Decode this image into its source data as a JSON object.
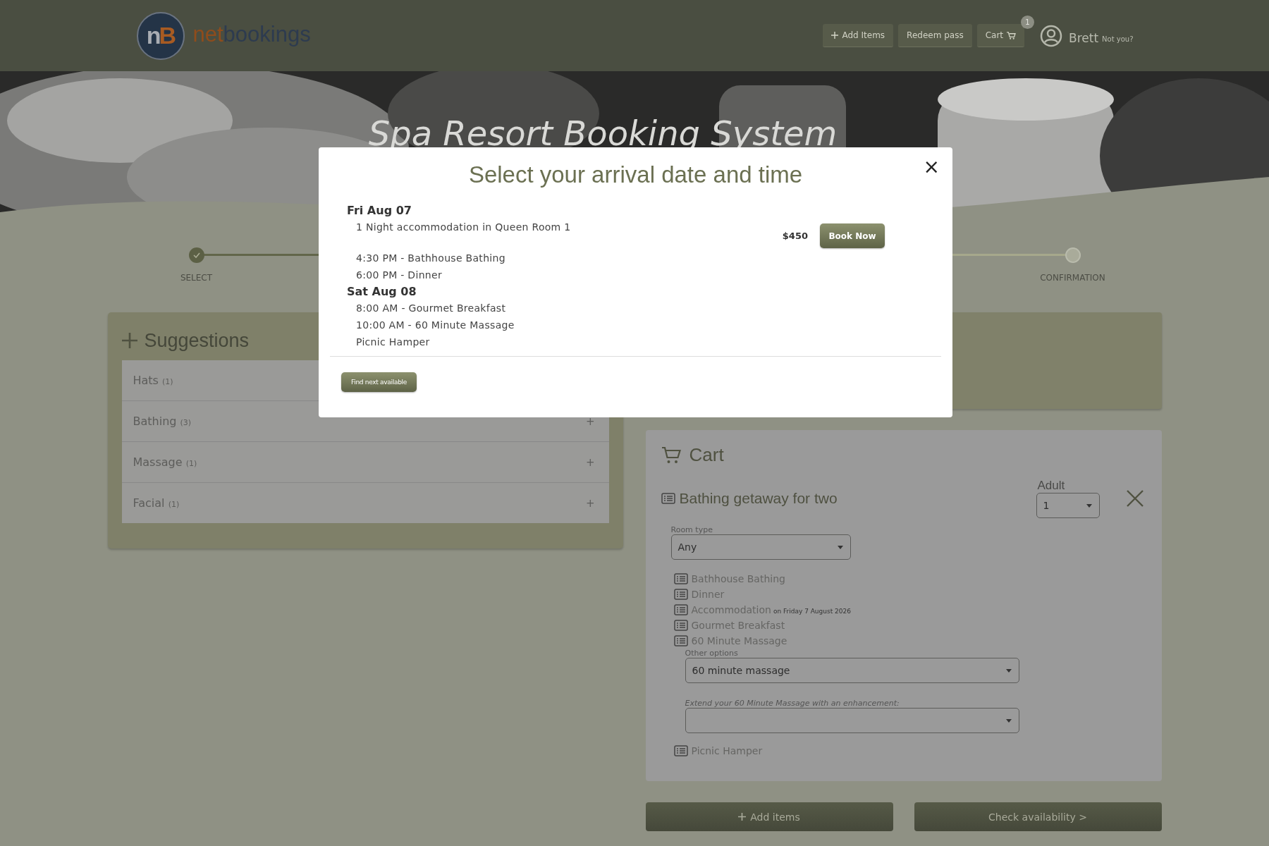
{
  "header": {
    "logo_mark": [
      "n",
      "B"
    ],
    "logo_text": [
      "net",
      "bookings"
    ],
    "buttons": [
      {
        "kind": "add",
        "label": "Add Items"
      },
      {
        "kind": "plain",
        "label": "Redeem pass"
      },
      {
        "kind": "cart",
        "label": "Cart",
        "badge": "1"
      }
    ],
    "user": {
      "name": "Brett",
      "link": "Not you?"
    }
  },
  "hero": {
    "title": "Spa Resort Booking System"
  },
  "steps": [
    {
      "label": "SELECT",
      "done": true
    },
    {
      "label": "CONFIRMATION",
      "done": false
    }
  ],
  "suggestions": {
    "title": "Suggestions",
    "items": [
      {
        "name": "Hats",
        "count": "(1)"
      },
      {
        "name": "Bathing",
        "count": "(3)",
        "expander": "+"
      },
      {
        "name": "Massage",
        "count": "(1)",
        "expander": "+"
      },
      {
        "name": "Facial",
        "count": "(1)",
        "expander": "+"
      }
    ]
  },
  "cart": {
    "title": "Cart",
    "package": {
      "name": "Bathing getaway for two",
      "qty_label": "Adult",
      "qty": "1",
      "room_label": "Room type",
      "room": "Any",
      "items": [
        {
          "kind": "item",
          "name": "Bathhouse Bathing"
        },
        {
          "kind": "item",
          "name": "Dinner"
        },
        {
          "kind": "item",
          "name": "Accommodation",
          "note": "on Friday 7 August 2026"
        },
        {
          "kind": "item",
          "name": "Gourmet Breakfast"
        },
        {
          "kind": "options",
          "name": "60 Minute Massage",
          "options_label": "Other options",
          "option": "60 minute massage",
          "extend_label": "Extend your 60 Minute Massage with an enhancement:"
        },
        {
          "kind": "item",
          "name": "Picnic Hamper"
        }
      ]
    }
  },
  "actions": [
    {
      "kind": "add",
      "label": "Add items"
    },
    {
      "kind": "next",
      "label": "Check availability >"
    }
  ],
  "modal": {
    "title": "Select your arrival date and time",
    "close": "×",
    "days": [
      {
        "date": "Fri Aug 07",
        "lines": [
          {
            "kind": "stay",
            "text": "1 Night accommodation in Queen Room 1"
          },
          {
            "kind": "session",
            "text": "4:30 PM - Bathhouse Bathing"
          },
          {
            "kind": "session",
            "text": "6:00 PM - Dinner"
          }
        ]
      },
      {
        "date": "Sat Aug 08",
        "lines": [
          {
            "kind": "session",
            "text": "8:00 AM - Gourmet Breakfast"
          },
          {
            "kind": "session",
            "text": "10:00 AM - 60 Minute Massage"
          },
          {
            "kind": "session",
            "text": "Picnic Hamper"
          }
        ]
      }
    ],
    "price": "$450",
    "book": "Book Now",
    "find": "Find next available"
  }
}
